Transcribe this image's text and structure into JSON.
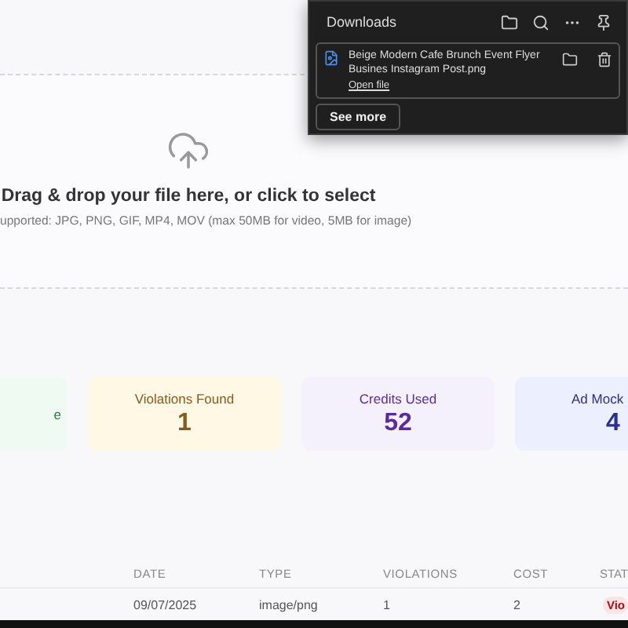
{
  "dropzone": {
    "title": "Drag & drop your file here, or click to select",
    "hint": "upported: JPG, PNG, GIF, MP4, MOV (max 50MB for video, 5MB for image)"
  },
  "stats": [
    {
      "label": "e",
      "color": "#eefaf2"
    },
    {
      "label": "Violations Found",
      "value": "1",
      "color": "#fef8e4"
    },
    {
      "label": "Credits Used",
      "value": "52",
      "color": "#f4f1fc"
    },
    {
      "label": "Ad Mock",
      "value": "4",
      "color": "#eceffd"
    }
  ],
  "table": {
    "columns": [
      "DATE",
      "TYPE",
      "VIOLATIONS",
      "COST",
      "STAT"
    ],
    "rows": [
      {
        "cells": [
          "09/07/2025",
          "image/png",
          "1",
          "2"
        ],
        "status": "Vio"
      }
    ]
  },
  "downloads": {
    "title": "Downloads",
    "items": [
      {
        "name": "Beige Modern Cafe Brunch Event Flyer Busines Instagram Post.png",
        "action": "Open file"
      }
    ],
    "see_more": "See more"
  }
}
